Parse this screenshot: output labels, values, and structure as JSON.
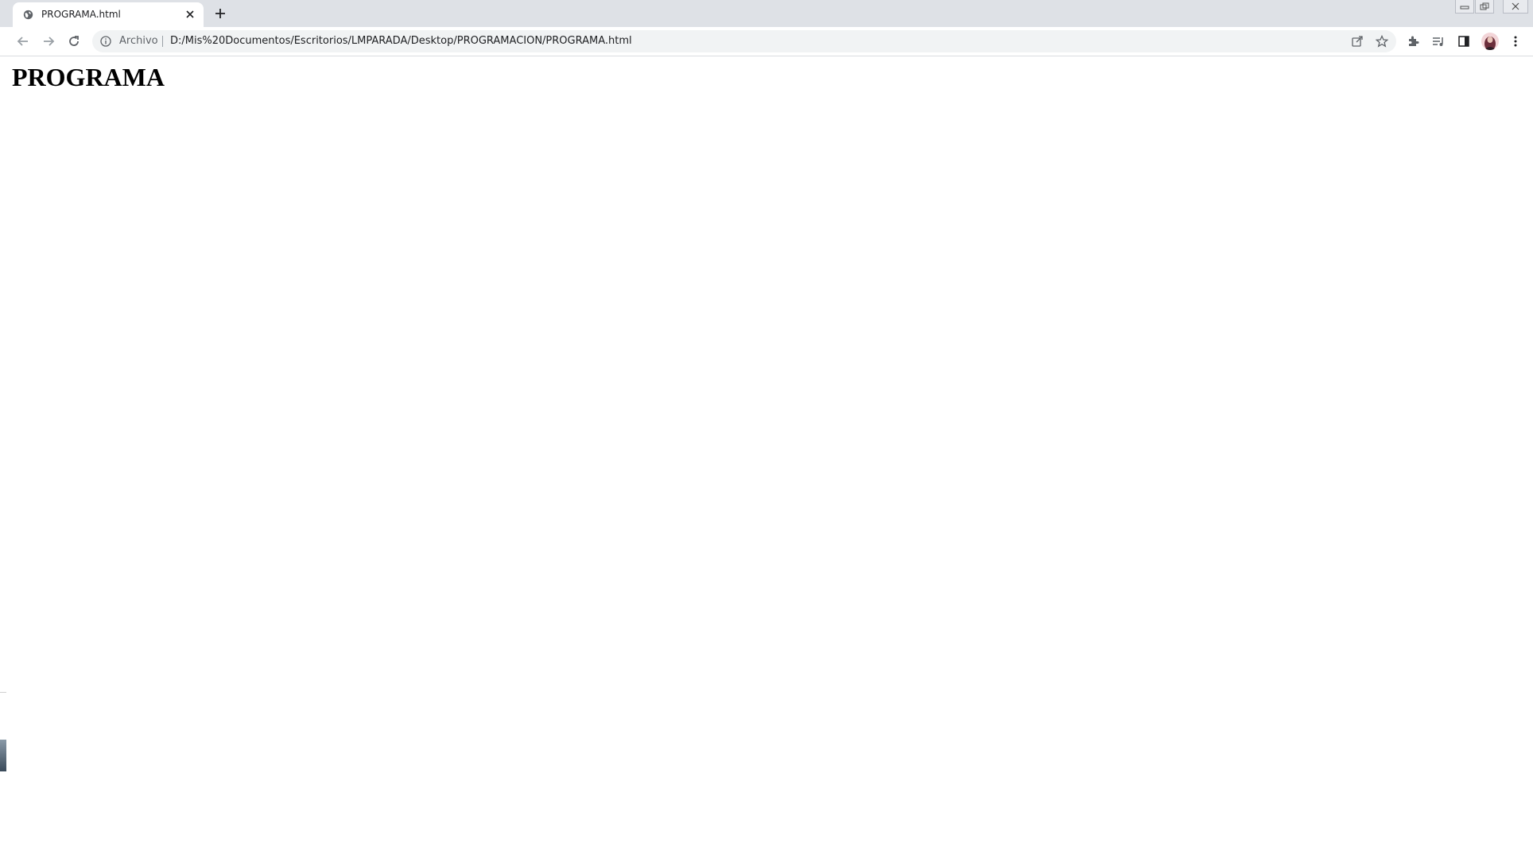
{
  "browser": {
    "tab": {
      "title": "PROGRAMA.html",
      "icon": "globe-icon"
    },
    "new_tab_icon": "plus-icon",
    "window_controls": [
      "minimize-icon",
      "restore-icon",
      "close-icon"
    ],
    "nav": {
      "back_icon": "arrow-left-icon",
      "forward_icon": "arrow-right-icon",
      "reload_icon": "reload-icon"
    },
    "address_bar": {
      "origin_label": "Archivo",
      "url": "D:/Mis%20Documentos/Escritorios/LMPARADA/Desktop/PROGRAMACION/PROGRAMA.html"
    },
    "toolbar_icons": [
      "share-icon",
      "star-icon",
      "extensions-icon",
      "reading-list-icon",
      "side-panel-icon",
      "profile-avatar",
      "menu-icon"
    ]
  },
  "page": {
    "heading": "PROGRAMA"
  },
  "colors": {
    "titlebar": "#dee1e6",
    "omnibox": "#f1f3f4",
    "icon": "#5f6368",
    "text": "#202124"
  }
}
